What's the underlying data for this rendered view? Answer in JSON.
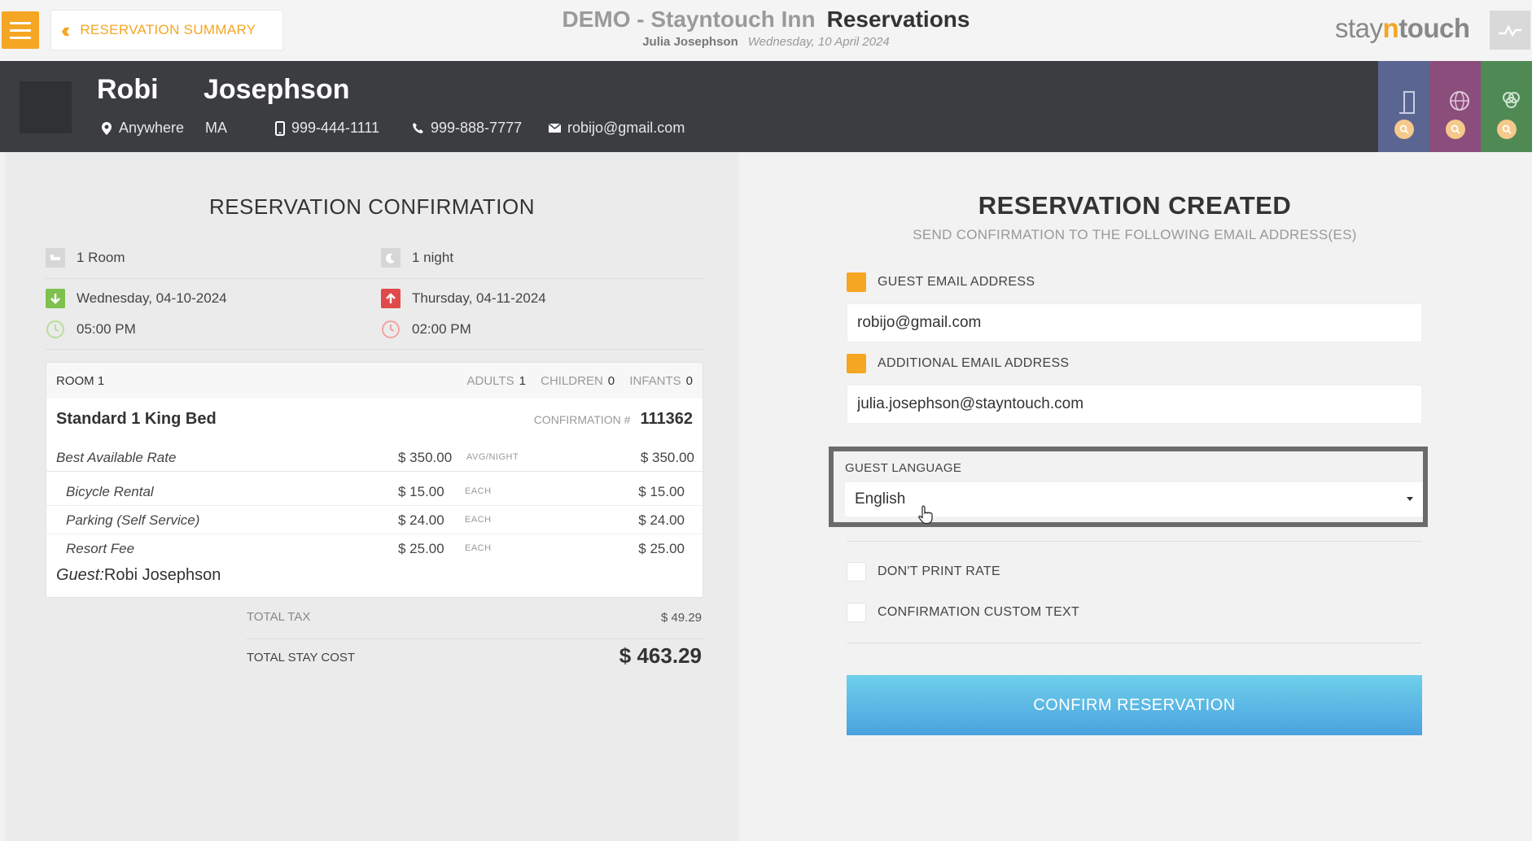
{
  "header": {
    "back_label": "RESERVATION SUMMARY",
    "hotel_name": "DEMO - Stayntouch Inn",
    "page_title": "Reservations",
    "user_name": "Julia Josephson",
    "business_date": "Wednesday, 10 April 2024",
    "brand": {
      "part1": "stay",
      "part2": "n",
      "part3": "touch"
    }
  },
  "guest": {
    "first_name": "Robi",
    "last_name": "Josephson",
    "city": "Anywhere",
    "state": "MA",
    "mobile": "999-444-1111",
    "phone": "999-888-7777",
    "email": "robijo@gmail.com"
  },
  "colors": {
    "accent": "#f5a623",
    "header_dark": "#3b3d40",
    "tab_blue": "#5b6591",
    "tab_purple": "#8a4d7c",
    "tab_green": "#4f8a55",
    "arrival_green": "#7fc14f",
    "departure_red": "#e04a4a",
    "button_blue": "#55b3e3"
  },
  "confirmation": {
    "title": "RESERVATION CONFIRMATION",
    "rooms": "1 Room",
    "nights": "1 night",
    "arrival_date": "Wednesday, 04-10-2024",
    "departure_date": "Thursday, 04-11-2024",
    "arrival_time": "05:00 PM",
    "departure_time": "02:00 PM",
    "room": {
      "label": "ROOM 1",
      "adults_label": "ADULTS",
      "adults": "1",
      "children_label": "CHILDREN",
      "children": "0",
      "infants_label": "INFANTS",
      "infants": "0",
      "type": "Standard 1 King Bed",
      "confirmation_label": "CONFIRMATION #",
      "confirmation_number": "111362",
      "rate_name": "Best Available Rate",
      "rate_price": "$ 350.00",
      "rate_unit": "AVG/NIGHT",
      "rate_total": "$ 350.00",
      "addons": [
        {
          "name": "Bicycle Rental",
          "price": "$ 15.00",
          "unit": "EACH",
          "total": "$ 15.00"
        },
        {
          "name": "Parking (Self Service)",
          "price": "$ 24.00",
          "unit": "EACH",
          "total": "$ 24.00"
        },
        {
          "name": "Resort Fee",
          "price": "$ 25.00",
          "unit": "EACH",
          "total": "$ 25.00"
        }
      ],
      "guest_label": "Guest:",
      "guest_name": "Robi Josephson"
    },
    "total_tax_label": "TOTAL TAX",
    "total_tax": "$ 49.29",
    "total_stay_label": "TOTAL STAY COST",
    "total_stay": "$ 463.29"
  },
  "created": {
    "title": "RESERVATION CREATED",
    "subtitle": "SEND CONFIRMATION TO THE FOLLOWING EMAIL ADDRESS(ES)",
    "guest_email_label": "GUEST EMAIL ADDRESS",
    "guest_email": "robijo@gmail.com",
    "additional_email_label": "ADDITIONAL EMAIL ADDRESS",
    "additional_email": "julia.josephson@stayntouch.com",
    "language_label": "GUEST LANGUAGE",
    "language": "English",
    "dont_print_rate_label": "DON'T PRINT RATE",
    "custom_text_label": "CONFIRMATION CUSTOM TEXT",
    "confirm_button": "CONFIRM RESERVATION"
  }
}
